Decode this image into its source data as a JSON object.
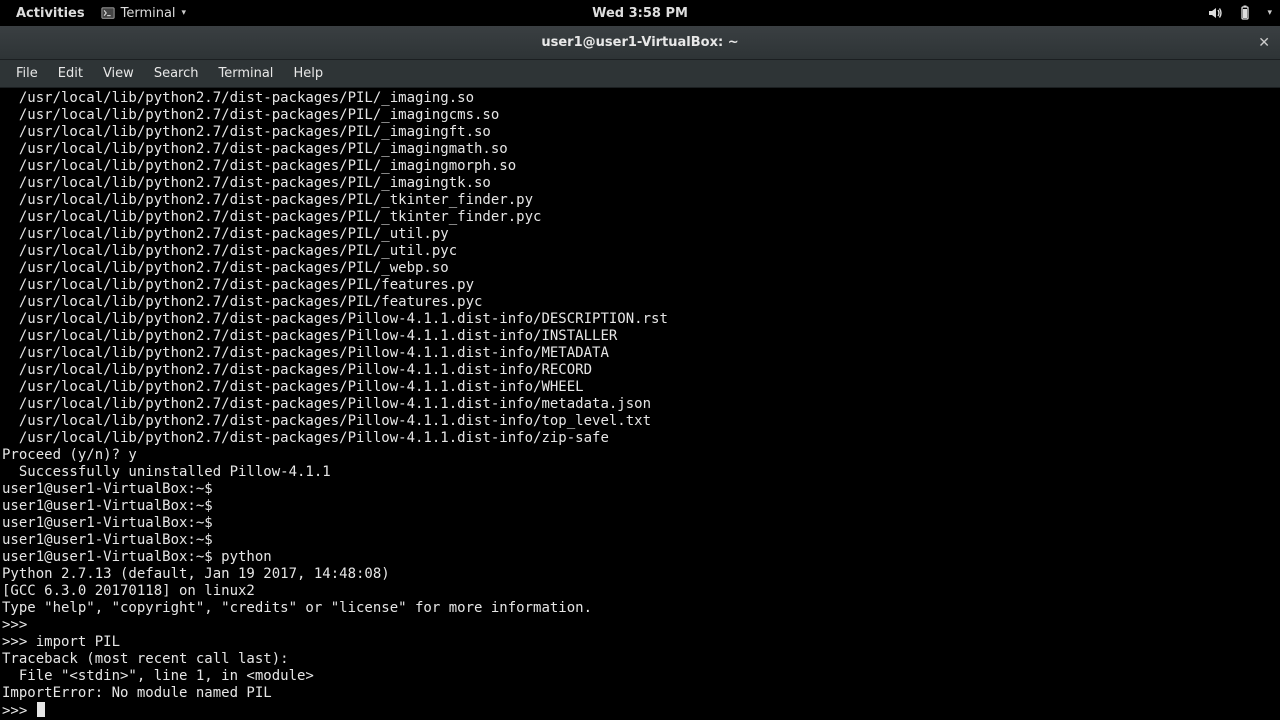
{
  "panel": {
    "activities": "Activities",
    "app_name": "Terminal",
    "clock": "Wed  3:58 PM"
  },
  "window": {
    "title": "user1@user1-VirtualBox: ~"
  },
  "menu": {
    "file": "File",
    "edit": "Edit",
    "view": "View",
    "search": "Search",
    "terminal": "Terminal",
    "help": "Help"
  },
  "terminal_lines": [
    "  /usr/local/lib/python2.7/dist-packages/PIL/_imaging.so",
    "  /usr/local/lib/python2.7/dist-packages/PIL/_imagingcms.so",
    "  /usr/local/lib/python2.7/dist-packages/PIL/_imagingft.so",
    "  /usr/local/lib/python2.7/dist-packages/PIL/_imagingmath.so",
    "  /usr/local/lib/python2.7/dist-packages/PIL/_imagingmorph.so",
    "  /usr/local/lib/python2.7/dist-packages/PIL/_imagingtk.so",
    "  /usr/local/lib/python2.7/dist-packages/PIL/_tkinter_finder.py",
    "  /usr/local/lib/python2.7/dist-packages/PIL/_tkinter_finder.pyc",
    "  /usr/local/lib/python2.7/dist-packages/PIL/_util.py",
    "  /usr/local/lib/python2.7/dist-packages/PIL/_util.pyc",
    "  /usr/local/lib/python2.7/dist-packages/PIL/_webp.so",
    "  /usr/local/lib/python2.7/dist-packages/PIL/features.py",
    "  /usr/local/lib/python2.7/dist-packages/PIL/features.pyc",
    "  /usr/local/lib/python2.7/dist-packages/Pillow-4.1.1.dist-info/DESCRIPTION.rst",
    "  /usr/local/lib/python2.7/dist-packages/Pillow-4.1.1.dist-info/INSTALLER",
    "  /usr/local/lib/python2.7/dist-packages/Pillow-4.1.1.dist-info/METADATA",
    "  /usr/local/lib/python2.7/dist-packages/Pillow-4.1.1.dist-info/RECORD",
    "  /usr/local/lib/python2.7/dist-packages/Pillow-4.1.1.dist-info/WHEEL",
    "  /usr/local/lib/python2.7/dist-packages/Pillow-4.1.1.dist-info/metadata.json",
    "  /usr/local/lib/python2.7/dist-packages/Pillow-4.1.1.dist-info/top_level.txt",
    "  /usr/local/lib/python2.7/dist-packages/Pillow-4.1.1.dist-info/zip-safe",
    "Proceed (y/n)? y",
    "  Successfully uninstalled Pillow-4.1.1",
    "user1@user1-VirtualBox:~$ ",
    "user1@user1-VirtualBox:~$ ",
    "user1@user1-VirtualBox:~$ ",
    "user1@user1-VirtualBox:~$ ",
    "user1@user1-VirtualBox:~$ python",
    "Python 2.7.13 (default, Jan 19 2017, 14:48:08) ",
    "[GCC 6.3.0 20170118] on linux2",
    "Type \"help\", \"copyright\", \"credits\" or \"license\" for more information.",
    ">>> ",
    ">>> import PIL",
    "Traceback (most recent call last):",
    "  File \"<stdin>\", line 1, in <module>",
    "ImportError: No module named PIL",
    ">>> "
  ]
}
